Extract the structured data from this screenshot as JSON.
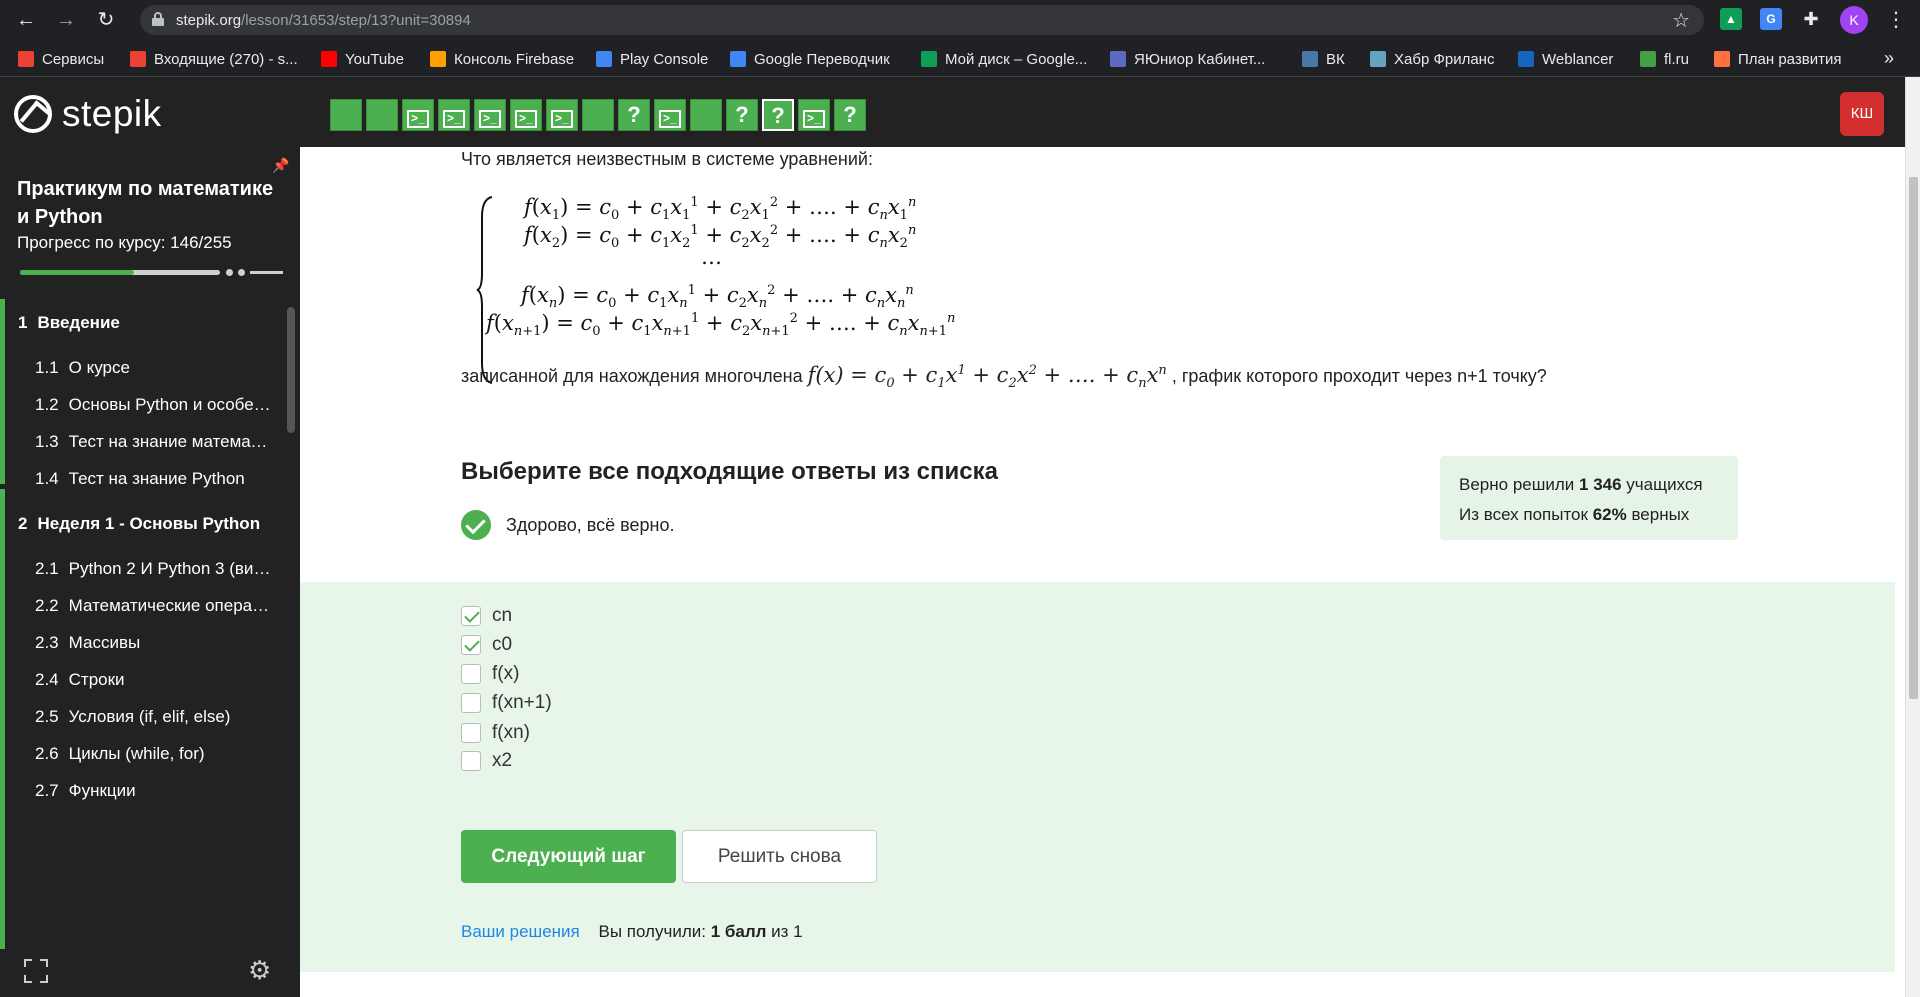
{
  "browser": {
    "url_host": "stepik.org",
    "url_path": "/lesson/31653/step/13?unit=30894",
    "bookmarks": [
      {
        "label": "Сервисы",
        "icon": "apps-grid-icon",
        "color": "#ea4335"
      },
      {
        "label": "Входящие (270) - s...",
        "icon": "gmail-icon",
        "color": "#ea4335"
      },
      {
        "label": "YouTube",
        "icon": "youtube-icon",
        "color": "#ff0000"
      },
      {
        "label": "Консоль Firebase",
        "icon": "firebase-icon",
        "color": "#ffa000"
      },
      {
        "label": "Play Console",
        "icon": "play-console-icon",
        "color": "#4285f4"
      },
      {
        "label": "Google Переводчик",
        "icon": "google-translate-icon",
        "color": "#4285f4"
      },
      {
        "label": "Мой диск – Google...",
        "icon": "google-drive-icon",
        "color": "#0f9d58"
      },
      {
        "label": "ЯЮниор Кабинет...",
        "icon": "yajunior-icon",
        "color": "#5c6bc0"
      },
      {
        "label": "ВК",
        "icon": "vk-icon",
        "color": "#4a76a8"
      },
      {
        "label": "Хабр Фриланс",
        "icon": "habr-icon",
        "color": "#65a3be"
      },
      {
        "label": "Weblancer",
        "icon": "weblancer-icon",
        "color": "#1565c0"
      },
      {
        "label": "fl.ru",
        "icon": "flru-icon",
        "color": "#43a047"
      },
      {
        "label": "План развития",
        "icon": "plan-icon",
        "color": "#ff7043"
      }
    ],
    "profile_initial": "K"
  },
  "header": {
    "logo_text": "stepik",
    "user_badge": "КШ",
    "steps": [
      {
        "type": "done"
      },
      {
        "type": "done"
      },
      {
        "type": "code"
      },
      {
        "type": "code"
      },
      {
        "type": "code"
      },
      {
        "type": "code"
      },
      {
        "type": "code"
      },
      {
        "type": "done"
      },
      {
        "type": "quiz"
      },
      {
        "type": "code"
      },
      {
        "type": "done"
      },
      {
        "type": "quiz"
      },
      {
        "type": "quiz",
        "current": true
      },
      {
        "type": "code"
      },
      {
        "type": "quiz"
      }
    ]
  },
  "sidebar": {
    "course_title": "Практикум по математике и Python",
    "progress_label": "Прогресс по курсу:  146/255",
    "progress_fraction": 0.57,
    "items": [
      {
        "kind": "section",
        "num": "1",
        "label": "Введение"
      },
      {
        "kind": "lesson",
        "num": "1.1",
        "label": "О курсе"
      },
      {
        "kind": "lesson",
        "num": "1.2",
        "label": "Основы Python и особенности"
      },
      {
        "kind": "lesson",
        "num": "1.3",
        "label": "Тест на знание математики"
      },
      {
        "kind": "lesson",
        "num": "1.4",
        "label": "Тест на знание Python"
      },
      {
        "kind": "section",
        "num": "2",
        "label": "Неделя 1 - Основы Python"
      },
      {
        "kind": "lesson",
        "num": "2.1",
        "label": "Python 2 И Python 3 (видео)"
      },
      {
        "kind": "lesson",
        "num": "2.2",
        "label": "Математические операции"
      },
      {
        "kind": "lesson",
        "num": "2.3",
        "label": "Массивы"
      },
      {
        "kind": "lesson",
        "num": "2.4",
        "label": "Строки"
      },
      {
        "kind": "lesson",
        "num": "2.5",
        "label": "Условия (if, elif, else)"
      },
      {
        "kind": "lesson",
        "num": "2.6",
        "label": "Циклы (while, for)"
      },
      {
        "kind": "lesson",
        "num": "2.7",
        "label": "Функции"
      }
    ]
  },
  "quiz": {
    "question": "Что является неизвестным в системе уравнений:",
    "followup_before": "записанной для нахождения многочлена",
    "followup_after": ", график которого проходит через n+1 точку?",
    "choose_title": "Выберите все подходящие ответы из списка",
    "correct_message": "Здорово, всё верно.",
    "stats_line1_prefix": "Верно решили",
    "stats_solved": "1 346",
    "stats_line1_suffix": "учащихся",
    "stats_line2_prefix": "Из всех попыток",
    "stats_percent": "62%",
    "stats_line2_suffix": "верных",
    "options": [
      {
        "label": "cn",
        "checked": true
      },
      {
        "label": "c0",
        "checked": true
      },
      {
        "label": "f(x)",
        "checked": false
      },
      {
        "label": "f(xn+1)",
        "checked": false
      },
      {
        "label": "f(xn)",
        "checked": false
      },
      {
        "label": "x2",
        "checked": false
      }
    ],
    "next_button": "Следующий шаг",
    "retry_button": "Решить снова",
    "solutions_link": "Ваши решения",
    "score_prefix": "Вы получили:",
    "score_value": "1 балл",
    "score_suffix": "из 1"
  },
  "colors": {
    "accent_green": "#4caf50",
    "answers_bg": "#e8f5e9",
    "badge_red": "#d32f2f",
    "link_blue": "#1e88e5"
  }
}
